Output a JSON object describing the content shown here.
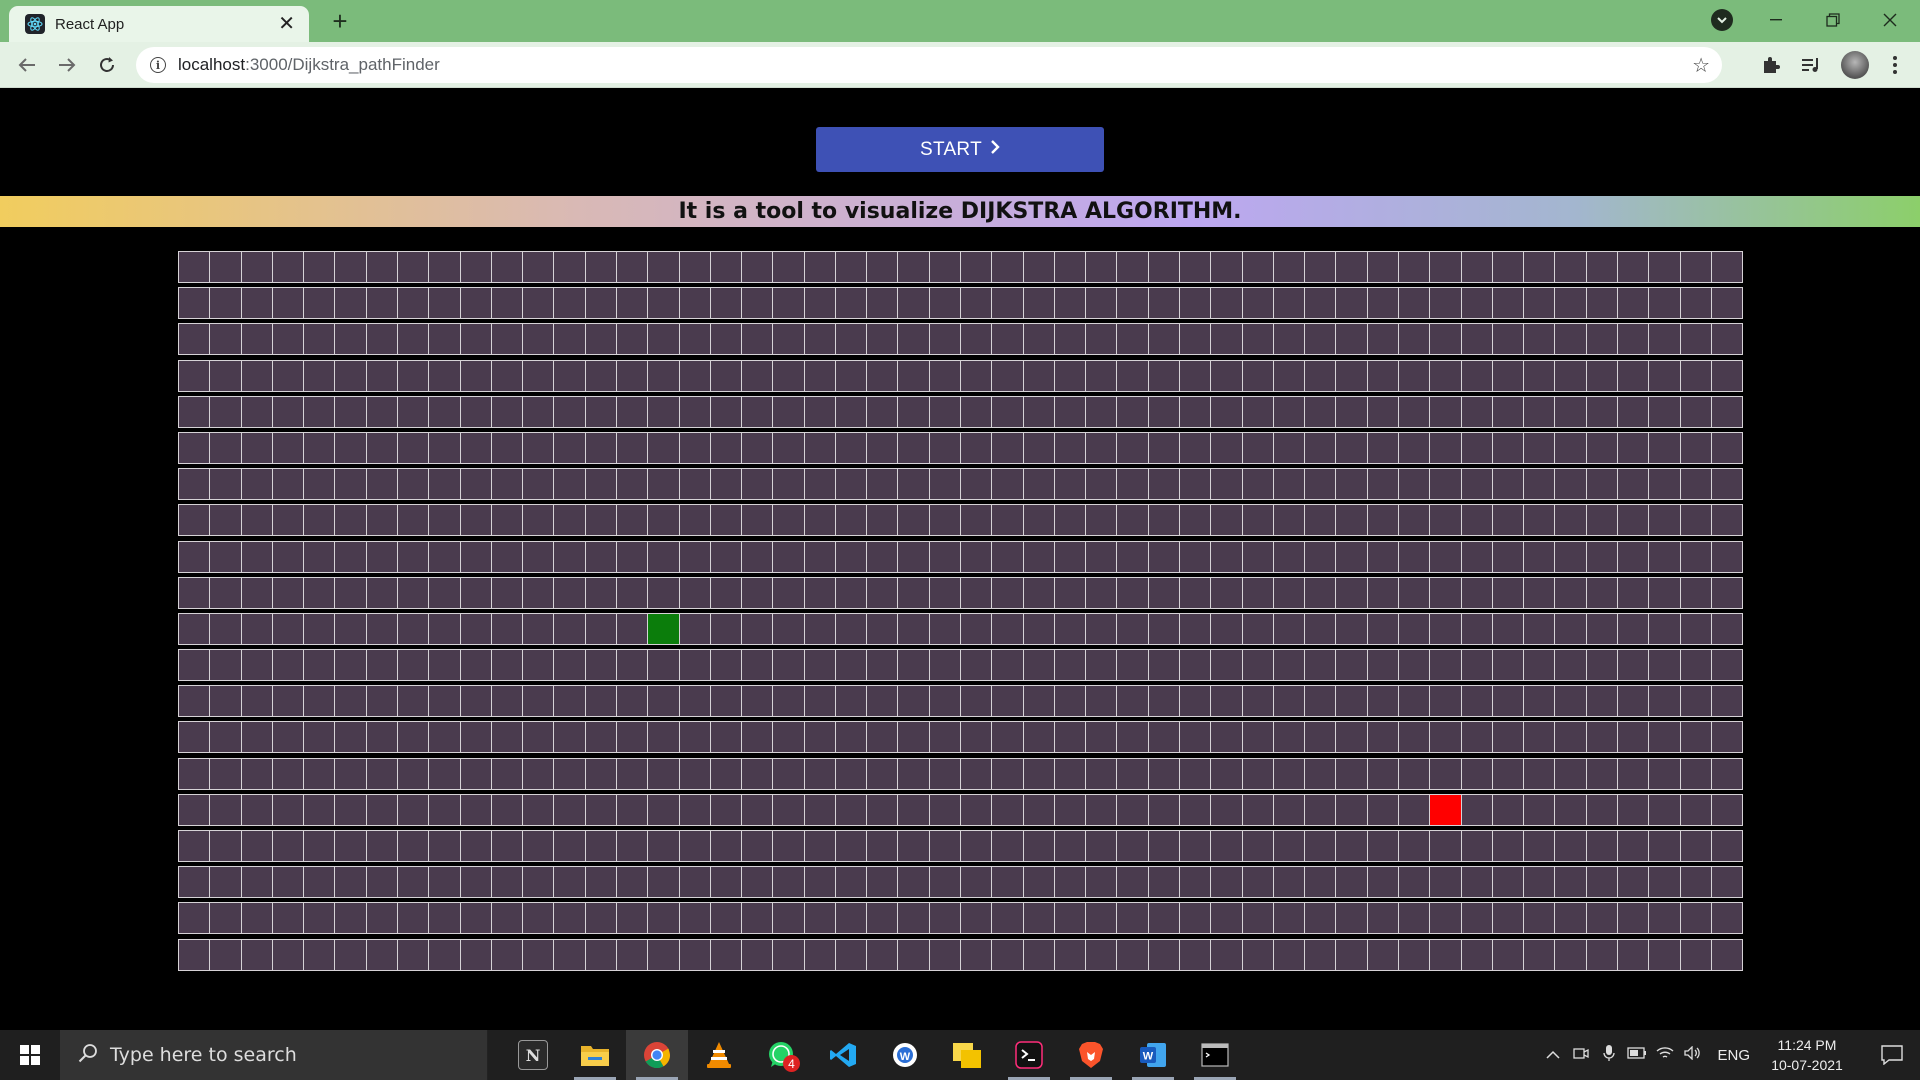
{
  "browser": {
    "tab_title": "React App",
    "url_host": "localhost",
    "url_rest": ":3000/Dijkstra_pathFinder",
    "icons": [
      "react-icon",
      "close-icon",
      "plus-icon",
      "back-icon",
      "forward-icon",
      "reload-icon",
      "info-icon",
      "star-icon",
      "extension-icon",
      "media-icon",
      "profile-avatar",
      "menu-icon"
    ]
  },
  "page": {
    "start_label": "START",
    "banner_text": "It is a tool to visualize DIJKSTRA ALGORITHM.",
    "grid": {
      "rows": 20,
      "cols": 50,
      "cell_color": "#4a3b4e",
      "border_color": "#d6d2d6",
      "start_node": {
        "row": 10,
        "col": 15,
        "color": "#0b7d0b"
      },
      "end_node": {
        "row": 15,
        "col": 40,
        "color": "#ff0000"
      }
    },
    "accent_color": "#3e51b5"
  },
  "taskbar": {
    "search_placeholder": "Type here to search",
    "apps": [
      "notion",
      "file-explorer",
      "chrome",
      "vlc",
      "whatsapp",
      "vscode",
      "app-w",
      "sticky-notes",
      "terminal",
      "brave",
      "word",
      "cmd"
    ],
    "whatsapp_badge": "4",
    "lang": "ENG",
    "time": "11:24 PM",
    "date": "10-07-2021"
  }
}
